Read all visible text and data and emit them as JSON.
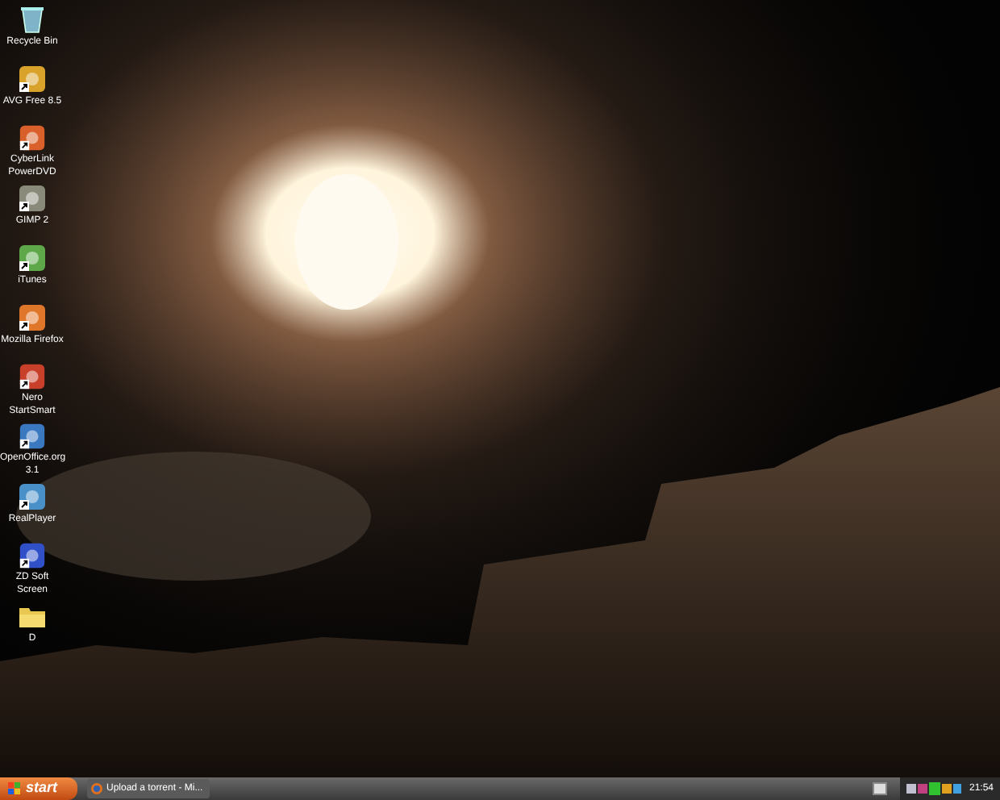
{
  "desktop_icons": [
    {
      "label": "Recycle Bin",
      "kind": "trash",
      "shortcut": false,
      "color": "#7fb3c8"
    },
    {
      "label": "AVG Free 8.5",
      "kind": "app",
      "shortcut": true,
      "color": "#d9a22a"
    },
    {
      "label": "CyberLink PowerDVD",
      "kind": "app",
      "shortcut": true,
      "color": "#d9602a"
    },
    {
      "label": "GIMP 2",
      "kind": "app",
      "shortcut": true,
      "color": "#8a8a7a"
    },
    {
      "label": "iTunes",
      "kind": "app",
      "shortcut": true,
      "color": "#5fa84a"
    },
    {
      "label": "Mozilla Firefox",
      "kind": "app",
      "shortcut": true,
      "color": "#e0762a"
    },
    {
      "label": "Nero StartSmart",
      "kind": "app",
      "shortcut": true,
      "color": "#c8402a"
    },
    {
      "label": "OpenOffice.org 3.1",
      "kind": "app",
      "shortcut": true,
      "color": "#3a78c0"
    },
    {
      "label": "RealPlayer",
      "kind": "app",
      "shortcut": true,
      "color": "#4a90c8"
    },
    {
      "label": "ZD Soft Screen",
      "kind": "app",
      "shortcut": true,
      "color": "#3050c8"
    },
    {
      "label": "D",
      "kind": "folder",
      "shortcut": false,
      "color": "#e8c850"
    }
  ],
  "taskbar": {
    "start": "start",
    "tasks": [
      {
        "label": "Upload a torrent - Mi...",
        "selected": false
      }
    ],
    "clock": "21:54"
  }
}
